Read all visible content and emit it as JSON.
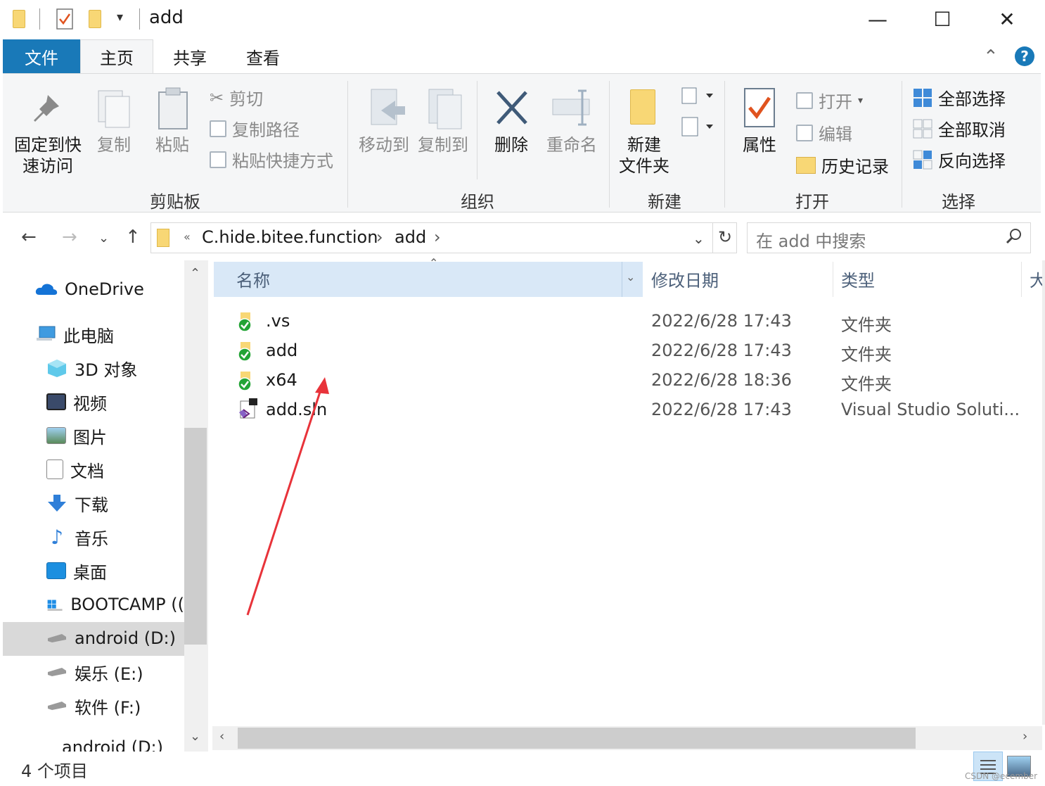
{
  "window": {
    "title": "add",
    "minimize": "—",
    "maximize": "☐",
    "close": "✕"
  },
  "tabs": [
    {
      "label": "文件"
    },
    {
      "label": "主页"
    },
    {
      "label": "共享"
    },
    {
      "label": "查看"
    }
  ],
  "ribbon": {
    "clipboard": {
      "pin_line1": "固定到快",
      "pin_line2": "速访问",
      "copy": "复制",
      "paste": "粘贴",
      "cut": "剪切",
      "copy_path": "复制路径",
      "paste_shortcut": "粘贴快捷方式",
      "group": "剪贴板"
    },
    "organize": {
      "move_to": "移动到",
      "copy_to": "复制到",
      "delete": "删除",
      "rename": "重命名",
      "group": "组织"
    },
    "new": {
      "new_folder_line1": "新建",
      "new_folder_line2": "文件夹",
      "group": "新建"
    },
    "open": {
      "properties": "属性",
      "open": "打开",
      "edit": "编辑",
      "history": "历史记录",
      "group": "打开"
    },
    "select": {
      "select_all": "全部选择",
      "select_none": "全部取消",
      "invert": "反向选择",
      "group": "选择"
    }
  },
  "address": {
    "overflow": "«",
    "crumb1": "C.hide.bitee.function",
    "sep": "›",
    "crumb2": "add",
    "search_placeholder": "在 add 中搜索"
  },
  "nav": {
    "items": [
      {
        "label": "OneDrive"
      },
      {
        "label": "此电脑"
      },
      {
        "label": "3D 对象"
      },
      {
        "label": "视频"
      },
      {
        "label": "图片"
      },
      {
        "label": "文档"
      },
      {
        "label": "下载"
      },
      {
        "label": "音乐"
      },
      {
        "label": "桌面"
      },
      {
        "label": "BOOTCAMP (("
      },
      {
        "label": "android (D:)"
      },
      {
        "label": "娱乐 (E:)"
      },
      {
        "label": "软件 (F:)"
      },
      {
        "label": "android (D:)"
      }
    ]
  },
  "columns": {
    "name": "名称",
    "modified": "修改日期",
    "type": "类型",
    "size": "大"
  },
  "files": [
    {
      "name": ".vs",
      "modified": "2022/6/28 17:43",
      "type": "文件夹"
    },
    {
      "name": "add",
      "modified": "2022/6/28 17:43",
      "type": "文件夹"
    },
    {
      "name": "x64",
      "modified": "2022/6/28 18:36",
      "type": "文件夹"
    },
    {
      "name": "add.sln",
      "modified": "2022/6/28 17:43",
      "type": "Visual Studio Soluti..."
    }
  ],
  "status": {
    "count": "4 个项目",
    "watermark": "CSDN @ecember"
  },
  "colors": {
    "accent": "#1979b8",
    "selected_header": "#d9e8f7",
    "folder": "#f8d775"
  }
}
